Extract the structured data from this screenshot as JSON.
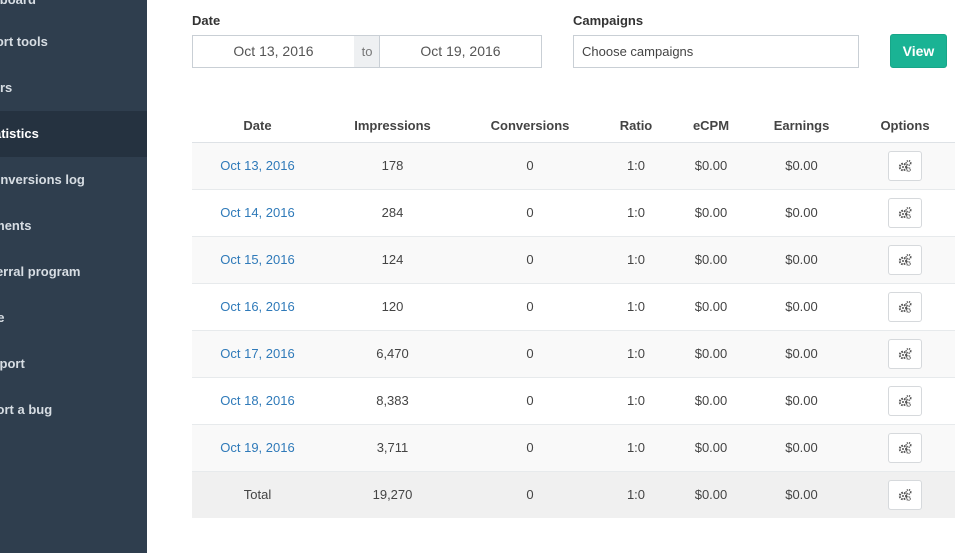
{
  "sidebar": {
    "items": [
      {
        "label": "Dashboard",
        "active": false
      },
      {
        "label": "Export tools",
        "active": false
      },
      {
        "label": "Offers",
        "active": false
      },
      {
        "label": "Statistics",
        "active": true
      },
      {
        "label": "Conversions log",
        "active": false
      },
      {
        "label": "Payments",
        "active": false
      },
      {
        "label": "Referral program",
        "active": false
      },
      {
        "label": "Profile",
        "active": false
      },
      {
        "label": "Support",
        "active": false
      },
      {
        "label": "Report a bug",
        "active": false
      }
    ]
  },
  "filters": {
    "date_label": "Date",
    "date_from": "Oct 13, 2016",
    "date_to_word": "to",
    "date_to": "Oct 19, 2016",
    "campaigns_label": "Campaigns",
    "campaigns_placeholder": "Choose campaigns",
    "view_label": "View"
  },
  "table": {
    "headers": [
      "Date",
      "Impressions",
      "Conversions",
      "Ratio",
      "eCPM",
      "Earnings",
      "Options"
    ],
    "rows": [
      {
        "date": "Oct 13, 2016",
        "impressions": "178",
        "conversions": "0",
        "ratio": "1:0",
        "ecpm": "$0.00",
        "earnings": "$0.00"
      },
      {
        "date": "Oct 14, 2016",
        "impressions": "284",
        "conversions": "0",
        "ratio": "1:0",
        "ecpm": "$0.00",
        "earnings": "$0.00"
      },
      {
        "date": "Oct 15, 2016",
        "impressions": "124",
        "conversions": "0",
        "ratio": "1:0",
        "ecpm": "$0.00",
        "earnings": "$0.00"
      },
      {
        "date": "Oct 16, 2016",
        "impressions": "120",
        "conversions": "0",
        "ratio": "1:0",
        "ecpm": "$0.00",
        "earnings": "$0.00"
      },
      {
        "date": "Oct 17, 2016",
        "impressions": "6,470",
        "conversions": "0",
        "ratio": "1:0",
        "ecpm": "$0.00",
        "earnings": "$0.00"
      },
      {
        "date": "Oct 18, 2016",
        "impressions": "8,383",
        "conversions": "0",
        "ratio": "1:0",
        "ecpm": "$0.00",
        "earnings": "$0.00"
      },
      {
        "date": "Oct 19, 2016",
        "impressions": "3,711",
        "conversions": "0",
        "ratio": "1:0",
        "ecpm": "$0.00",
        "earnings": "$0.00"
      }
    ],
    "total": {
      "label": "Total",
      "impressions": "19,270",
      "conversions": "0",
      "ratio": "1:0",
      "ecpm": "$0.00",
      "earnings": "$0.00"
    },
    "options_icon": "gears-icon"
  },
  "colors": {
    "sidebar_bg": "#2f3e4e",
    "sidebar_active_bg": "#253240",
    "accent": "#1ab394",
    "link": "#2f7ab9"
  }
}
